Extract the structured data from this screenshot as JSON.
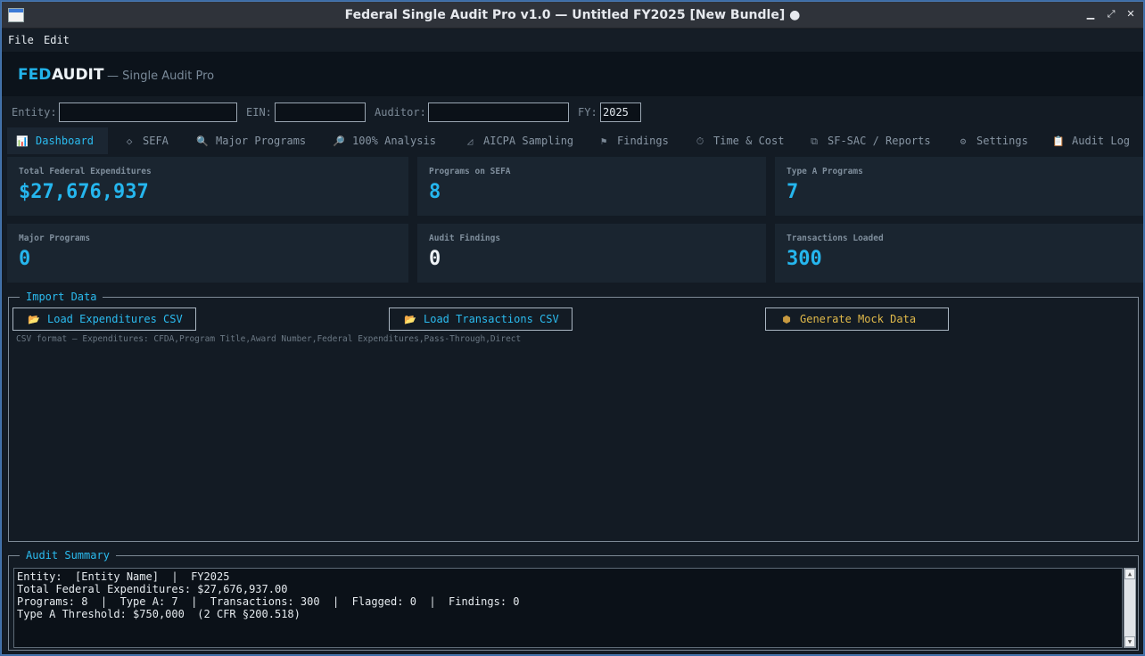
{
  "window": {
    "title": "Federal Single Audit Pro v1.0  —  Untitled FY2025  [New Bundle] ●",
    "min_glyph": "▁",
    "max_glyph": "⤢",
    "close_glyph": "✕"
  },
  "menu": {
    "file": "File",
    "edit": "Edit"
  },
  "brand": {
    "fed": "FED",
    "audit": "AUDIT",
    "subtitle": "— Single Audit Pro"
  },
  "entity_row": {
    "entity_label": "Entity:",
    "entity_value": "",
    "ein_label": "EIN:",
    "ein_value": "",
    "auditor_label": "Auditor:",
    "auditor_value": "",
    "fy_label": "FY:",
    "fy_value": "2025"
  },
  "tabs": [
    {
      "label": "Dashboard",
      "icon": "bar-chart-icon",
      "glyph": "📊",
      "active": true
    },
    {
      "label": "SEFA",
      "icon": "tag-icon",
      "glyph": "◇"
    },
    {
      "label": "Major Programs",
      "icon": "search-icon",
      "glyph": "🔍"
    },
    {
      "label": "100% Analysis",
      "icon": "magnifier-icon",
      "glyph": "🔎"
    },
    {
      "label": "AICPA Sampling",
      "icon": "triangle-ruler-icon",
      "glyph": "◿"
    },
    {
      "label": "Findings",
      "icon": "flag-icon",
      "glyph": "⚑"
    },
    {
      "label": "Time & Cost",
      "icon": "clock-icon",
      "glyph": "⏱"
    },
    {
      "label": "SF-SAC / Reports",
      "icon": "export-icon",
      "glyph": "⧉"
    },
    {
      "label": "Settings",
      "icon": "gear-icon",
      "glyph": "⚙"
    },
    {
      "label": "Audit Log",
      "icon": "clipboard-icon",
      "glyph": "📋"
    }
  ],
  "metrics": [
    {
      "label": "Total Federal Expenditures",
      "value": "$27,676,937",
      "style": "accent"
    },
    {
      "label": "Programs on SEFA",
      "value": "8",
      "style": "accent"
    },
    {
      "label": "Type A Programs",
      "value": "7",
      "style": "accent"
    },
    {
      "label": "Major Programs",
      "value": "0",
      "style": "accent"
    },
    {
      "label": "Audit Findings",
      "value": "0",
      "style": "white"
    },
    {
      "label": "Transactions Loaded",
      "value": "300",
      "style": "accent"
    }
  ],
  "import": {
    "title": "Import Data",
    "load_expenditures": "Load Expenditures CSV",
    "load_transactions": "Load Transactions CSV",
    "generate_mock": "Generate Mock Data",
    "csv_hint": "CSV format — Expenditures: CFDA,Program Title,Award Number,Federal Expenditures,Pass-Through,Direct"
  },
  "summary": {
    "title": "Audit Summary",
    "text": "Entity:  [Entity Name]  |  FY2025\nTotal Federal Expenditures: $27,676,937.00\nPrograms: 8  |  Type A: 7  |  Transactions: 300  |  Flagged: 0  |  Findings: 0\nType A Threshold: $750,000  (2 CFR §200.518)"
  },
  "colors": {
    "accent": "#25b6ee",
    "gold": "#e0b94a",
    "bg": "#131b24",
    "card": "#1a2530"
  }
}
